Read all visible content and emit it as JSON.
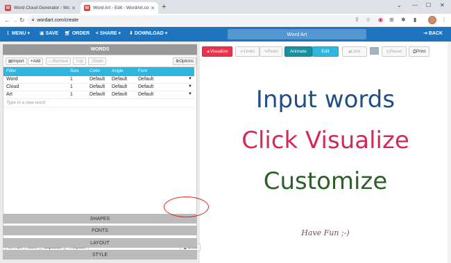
{
  "browser": {
    "tabs": [
      {
        "title": "Word Cloud Generator - WordArt..."
      },
      {
        "title": "Word Art - Edit - WordArt.com"
      }
    ],
    "url": "wordart.com/create"
  },
  "toolbar": {
    "menu": "MENU",
    "save": "SAVE",
    "order": "ORDER",
    "share": "SHARE",
    "download": "DOWNLOAD",
    "title": "Word Art",
    "back": "BACK"
  },
  "words_panel": {
    "header": "WORDS",
    "buttons": {
      "import": "Import",
      "add": "Add",
      "remove": "Remove",
      "up": "Up",
      "down": "Down",
      "options": "Options"
    },
    "columns": [
      "Filter",
      "Size",
      "Color",
      "Angle",
      "Font"
    ],
    "rows": [
      {
        "word": "Word",
        "size": "1",
        "color": "Default",
        "angle": "Default",
        "font": "Default"
      },
      {
        "word": "Cloud",
        "size": "1",
        "color": "Default",
        "angle": "Default",
        "font": "Default"
      },
      {
        "word": "Art",
        "size": "1",
        "color": "Default",
        "angle": "Default",
        "font": "Default"
      }
    ],
    "new_word_placeholder": "Type in a new word",
    "case_buttons": {
      "upper": "UPPER",
      "lower": "lower",
      "capitalize": "Capitalize",
      "replace": "Replace"
    },
    "clear": "Clear"
  },
  "accordion": [
    "SHAPES",
    "FONTS",
    "LAYOUT",
    "STYLE"
  ],
  "canvas_toolbar": {
    "visualize": "Visualize",
    "undo": "Undo",
    "redo": "Redo",
    "animate": "Animate",
    "edit": "Edit",
    "lock": "Lock",
    "reset": "Reset",
    "print": "Print"
  },
  "canvas": {
    "line1": "Input words",
    "line2": "Click Visualize",
    "line3": "Customize",
    "line4": "Have Fun ;-)"
  },
  "colors": {
    "toolbar_blue": "#1e73be",
    "table_header": "#2fb5de",
    "visualize_red": "#e8334a",
    "annotation_red": "#d9281f"
  }
}
